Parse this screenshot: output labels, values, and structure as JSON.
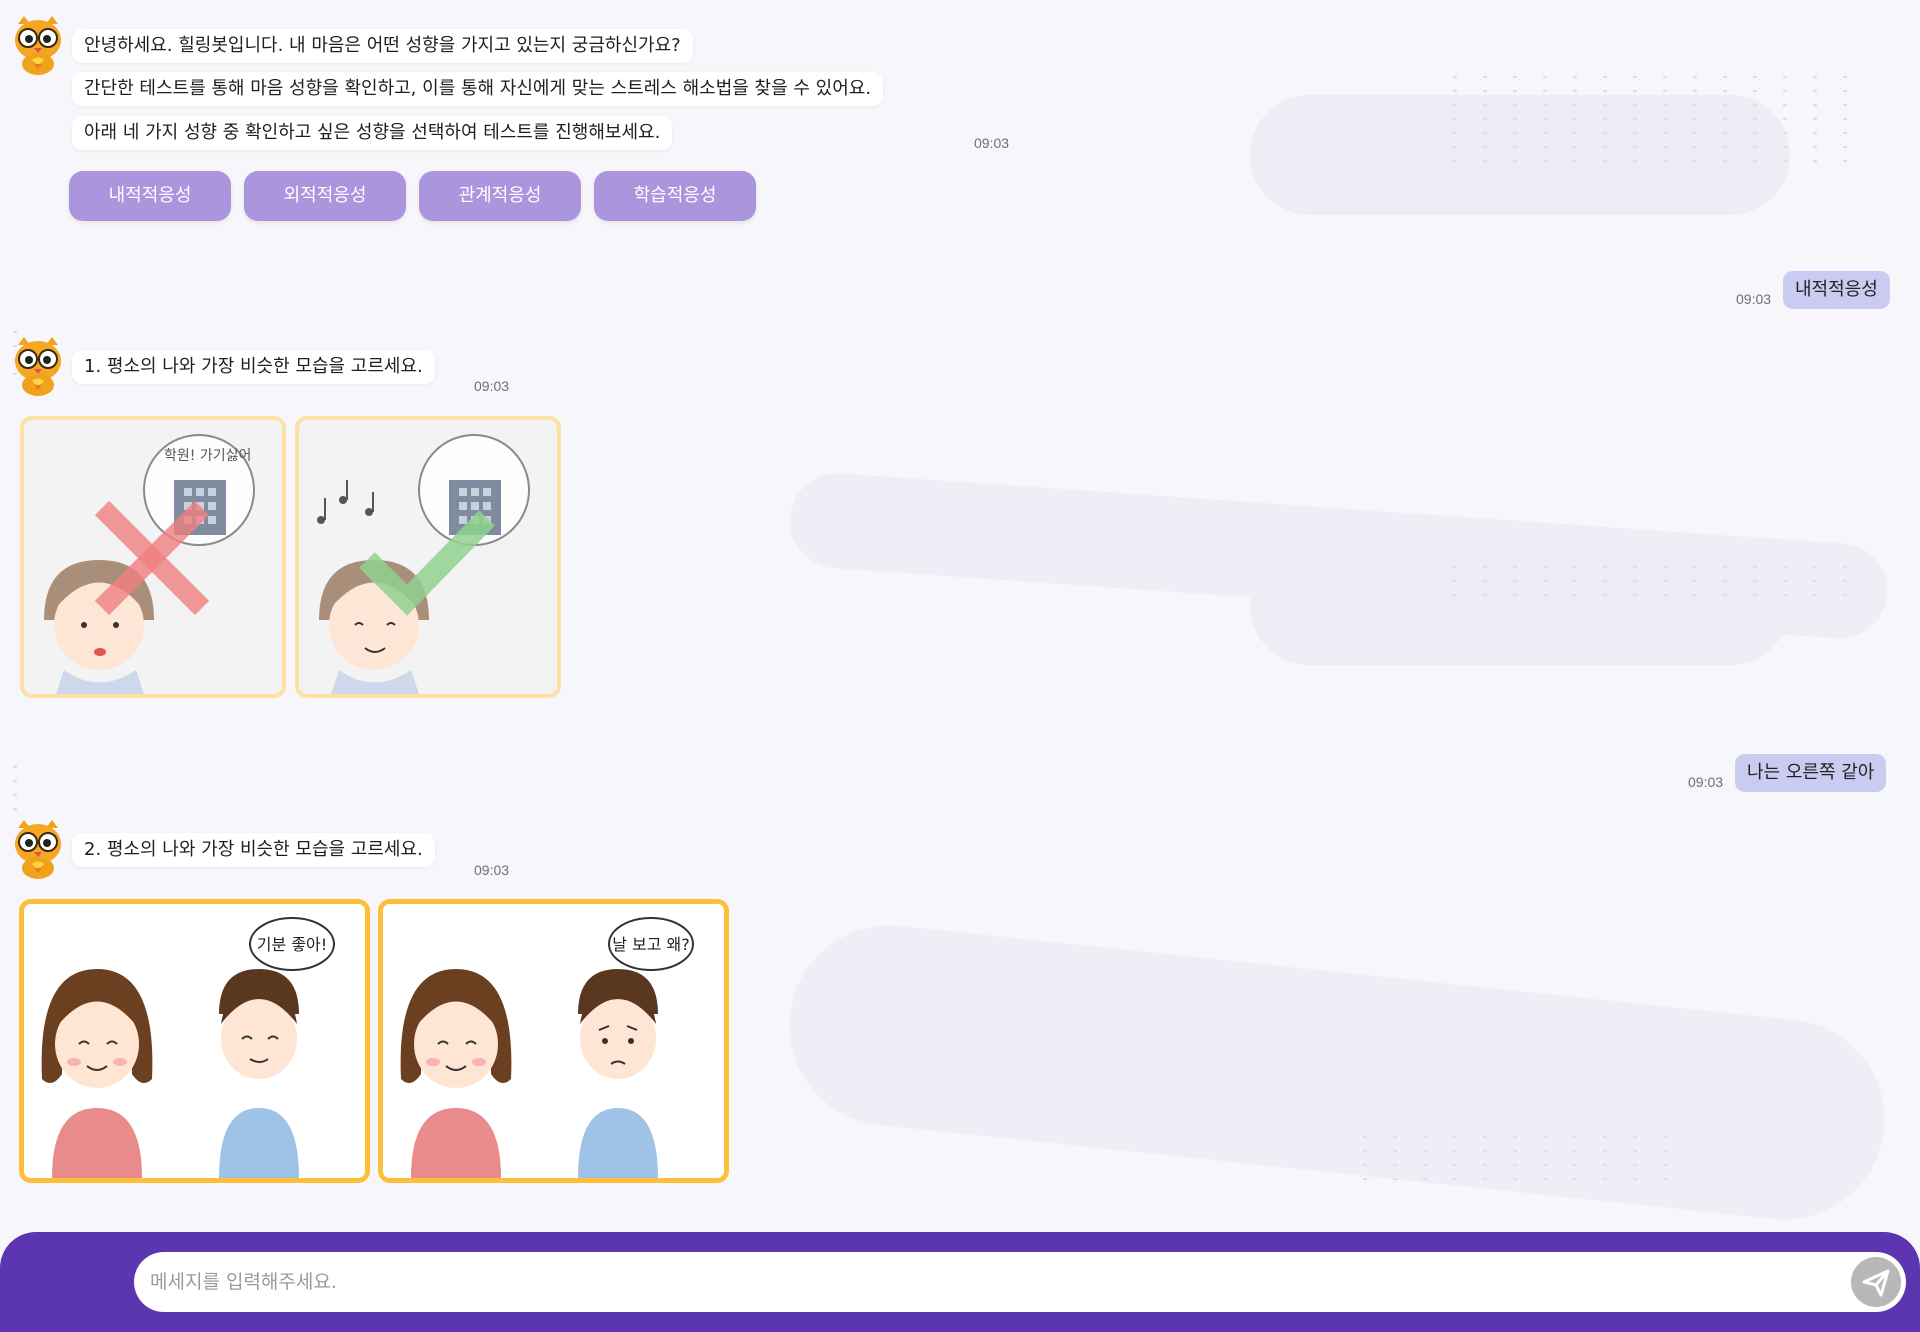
{
  "greeting": {
    "lines": [
      "안녕하세요. 힐링봇입니다. 내 마음은 어떤 성향을 가지고 있는지 궁금하신가요?",
      "간단한 테스트를 통해 마음 성향을 확인하고, 이를 통해 자신에게 맞는 스트레스 해소법을 찾을 수 있어요.",
      "아래 네 가지 성향 중 확인하고 싶은 성향을 선택하여 테스트를 진행해보세요."
    ],
    "time": "09:03",
    "options": [
      "내적적응성",
      "외적적응성",
      "관계적응성",
      "학습적응성"
    ]
  },
  "user_reply_1": {
    "text": "내적적응성",
    "time": "09:03"
  },
  "question_1": {
    "text": "1. 평소의 나와 가장 비슷한 모습을 고르세요.",
    "time": "09:03",
    "left_bubble_text": "학원! 가기싫어",
    "left_mark": "x-mark",
    "right_mark": "check-mark"
  },
  "user_reply_2": {
    "text": "나는 오른쪽 같아",
    "time": "09:03"
  },
  "question_2": {
    "text": "2. 평소의 나와 가장 비슷한 모습을 고르세요.",
    "time": "09:03",
    "left_thought": "기분 좋아!",
    "right_thought": "날 보고 왜?"
  },
  "composer": {
    "placeholder": "메세지를 입력해주세요.",
    "send_icon": "paper-plane-icon"
  },
  "colors": {
    "option_button": "#ab95dc",
    "user_bubble": "#c9cbf0",
    "bottom_bar": "#5c35b1",
    "card_border_active": "#fbbf3a",
    "card_border_faded": "#fbe1a3"
  }
}
